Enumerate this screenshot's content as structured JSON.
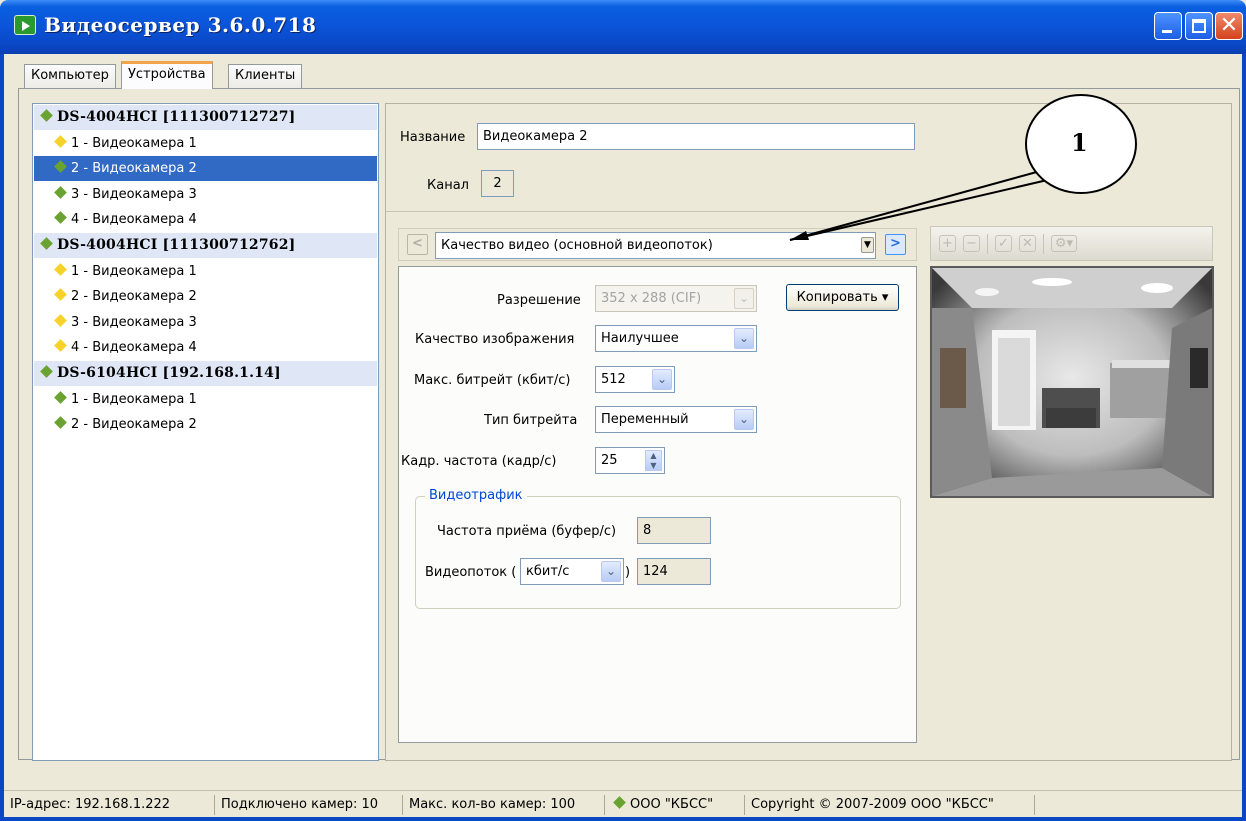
{
  "window": {
    "title": "Видеосервер 3.6.0.718"
  },
  "tabs": [
    "Компьютер",
    "Устройства",
    "Клиенты"
  ],
  "tree": [
    {
      "label": "DS-4004HCI [111300712727]",
      "type": "device",
      "status": "green"
    },
    {
      "label": "1 - Видеокамера 1",
      "type": "camera",
      "status": "yellow"
    },
    {
      "label": "2 - Видеокамера 2",
      "type": "camera",
      "status": "green",
      "selected": true
    },
    {
      "label": "3 - Видеокамера 3",
      "type": "camera",
      "status": "green"
    },
    {
      "label": "4 - Видеокамера 4",
      "type": "camera",
      "status": "green"
    },
    {
      "label": "DS-4004HCI [111300712762]",
      "type": "device",
      "status": "green"
    },
    {
      "label": "1 - Видеокамера 1",
      "type": "camera",
      "status": "yellow"
    },
    {
      "label": "2 - Видеокамера 2",
      "type": "camera",
      "status": "yellow"
    },
    {
      "label": "3 - Видеокамера 3",
      "type": "camera",
      "status": "yellow"
    },
    {
      "label": "4 - Видеокамера 4",
      "type": "camera",
      "status": "yellow"
    },
    {
      "label": "DS-6104HCI [192.168.1.14]",
      "type": "device",
      "status": "green"
    },
    {
      "label": "1 - Видеокамера 1",
      "type": "camera",
      "status": "green"
    },
    {
      "label": "2 - Видеокамера 2",
      "type": "camera",
      "status": "green"
    }
  ],
  "camera": {
    "name_label": "Название",
    "name_value": "Видеокамера 2",
    "channel_label": "Канал",
    "channel_value": "2"
  },
  "stream": {
    "selector_value": "Качество видео (основной видеопоток)"
  },
  "settings": {
    "resolution_label": "Разрешение",
    "resolution_value": "352 x 288 (CIF)",
    "copy_button": "Копировать ▾",
    "quality_label": "Качество изображения",
    "quality_value": "Наилучшее",
    "bitrate_label": "Макс. битрейт (кбит/с)",
    "bitrate_value": "512",
    "bitrate_type_label": "Тип битрейта",
    "bitrate_type_value": "Переменный",
    "framerate_label": "Кадр. частота (кадр/с)",
    "framerate_value": "25"
  },
  "traffic": {
    "title": "Видеотрафик",
    "rx_label": "Частота приёма (буфер/с)",
    "rx_value": "8",
    "stream_label_pre": "Видеопоток (",
    "stream_unit": "кбит/с",
    "stream_label_post": ")",
    "stream_value": "124"
  },
  "callout": {
    "number": "1"
  },
  "status": {
    "ip": "IP-адрес: 192.168.1.222",
    "connected": "Подключено камер: 10",
    "max": "Макс. кол-во камер: 100",
    "company": "ООО \"КБСС\"",
    "copyright": "Copyright © 2007-2009 ООО \"КБСС\""
  },
  "colors": {
    "titlebar": "#0a53d8",
    "selection": "#316ac5",
    "status_green": "#6aa332",
    "status_yellow": "#f6d22a",
    "group_title": "#0046d5"
  },
  "icons": {
    "app": "video-camera-icon",
    "toolbar": [
      "add-icon",
      "remove-icon",
      "apply-icon",
      "cancel-icon",
      "settings-icon"
    ]
  }
}
